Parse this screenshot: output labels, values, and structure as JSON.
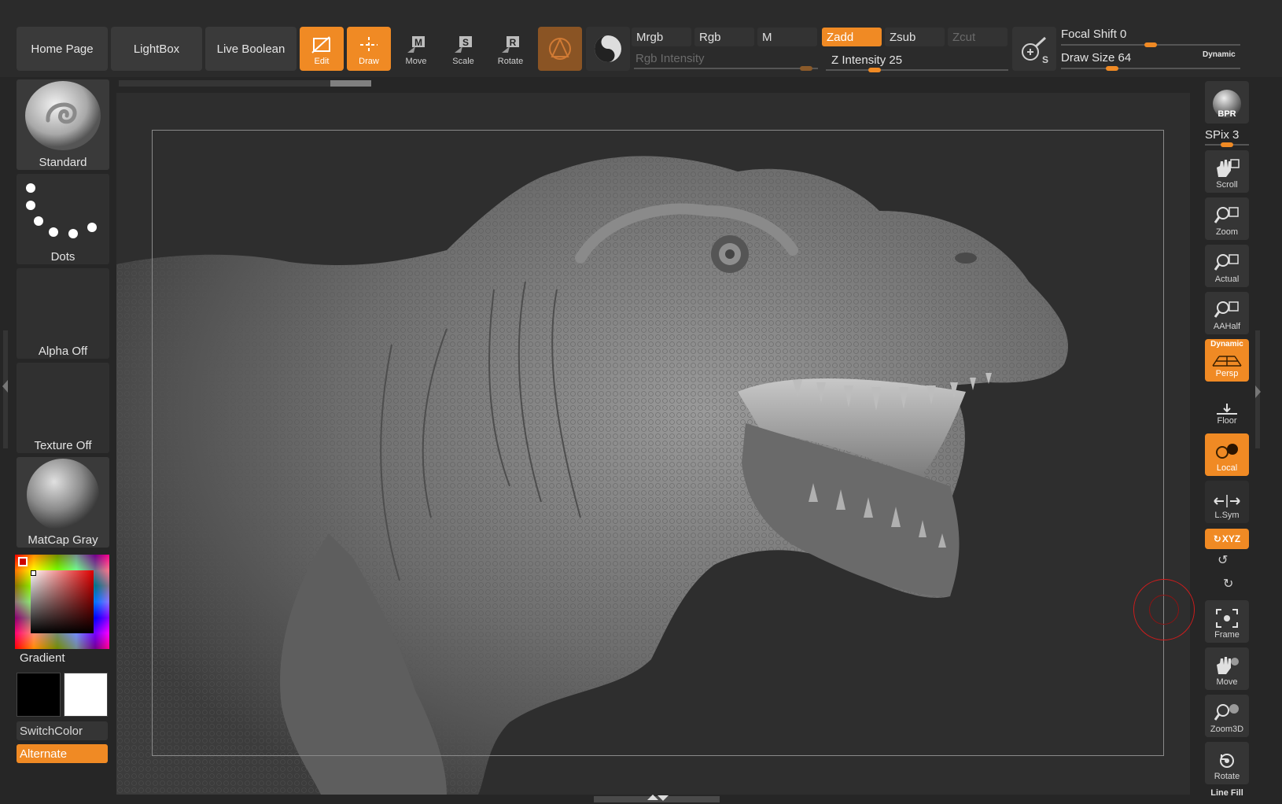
{
  "nav": {
    "home": "Home Page",
    "lightbox": "LightBox",
    "live_boolean": "Live Boolean"
  },
  "tools": {
    "edit": "Edit",
    "draw": "Draw",
    "move": "Move",
    "scale": "Scale",
    "rotate": "Rotate",
    "move_key": "M",
    "scale_key": "S",
    "rotate_key": "R"
  },
  "color_modes": {
    "mrgb": "Mrgb",
    "rgb": "Rgb",
    "m": "M",
    "rgb_intensity": "Rgb Intensity"
  },
  "sculpt_modes": {
    "zadd": "Zadd",
    "zsub": "Zsub",
    "zcut": "Zcut",
    "z_intensity": "Z Intensity 25"
  },
  "sliders": {
    "focal_shift": "Focal Shift 0",
    "draw_size": "Draw Size 64",
    "dynamic": "Dynamic",
    "rgb_intensity_value": 0.97,
    "z_intensity_value": 0.25,
    "focal_shift_value": 0.5,
    "draw_size_value": 0.27
  },
  "left_shelf": {
    "brush": "Standard",
    "stroke": "Dots",
    "alpha": "Alpha Off",
    "texture": "Texture Off",
    "material": "MatCap Gray",
    "gradient": "Gradient",
    "switch_color": "SwitchColor",
    "alternate": "Alternate"
  },
  "right_shelf": {
    "bpr": "BPR",
    "spix": "SPix 3",
    "spix_value": 0.5,
    "scroll": "Scroll",
    "zoom": "Zoom",
    "actual": "Actual",
    "aahalf": "AAHalf",
    "persp_tag": "Dynamic",
    "persp": "Persp",
    "floor": "Floor",
    "local": "Local",
    "lsym": "L.Sym",
    "xyz": "XYZ",
    "frame": "Frame",
    "move": "Move",
    "zoom3d": "Zoom3D",
    "rotate": "Rotate",
    "line_fill": "Line Fill"
  },
  "colors": {
    "accent": "#f08a24",
    "panel": "#3a3a3a",
    "background": "#262626",
    "viewport": "#2e2e2e",
    "cursor": "#d01c1c"
  }
}
